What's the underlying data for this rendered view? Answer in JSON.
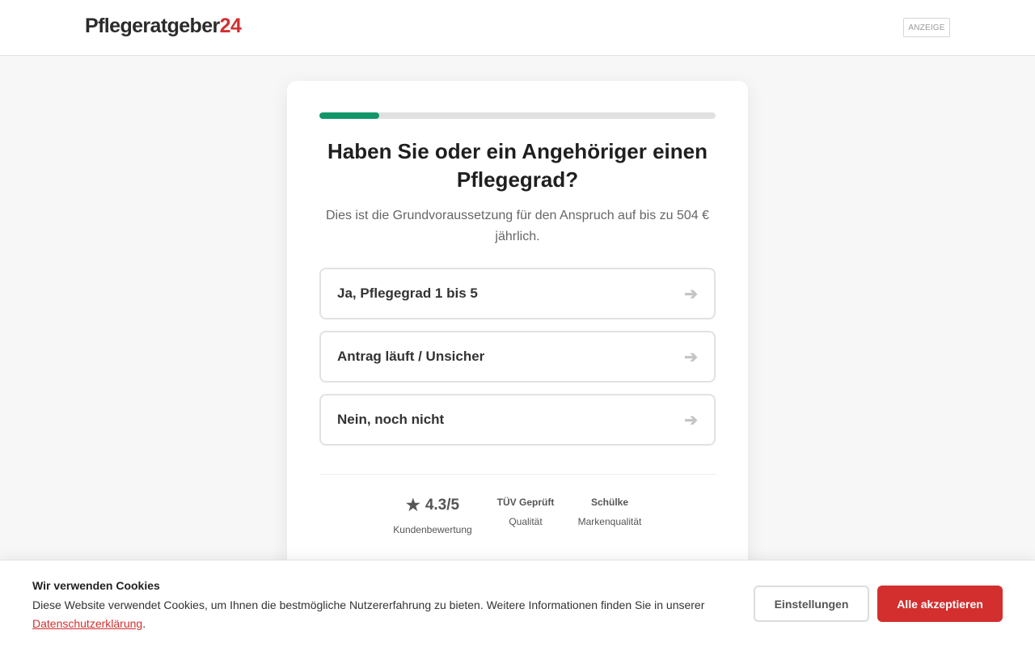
{
  "header": {
    "logo_text": "Pflegeratgeber",
    "logo_accent": "24",
    "ad_label": "ANZEIGE"
  },
  "quiz": {
    "progress_fraction": 0.15,
    "question": "Haben Sie oder ein Angehöriger einen Pflegegrad?",
    "subtitle": "Dies ist die Grundvoraussetzung für den Anspruch auf bis zu 504 € jährlich.",
    "options": [
      {
        "label": "Ja, Pflegegrad 1 bis 5",
        "icon": "arrow-right-icon"
      },
      {
        "label": "Antrag läuft / Unsicher",
        "icon": "arrow-right-icon"
      },
      {
        "label": "Nein, noch nicht",
        "icon": "arrow-right-icon"
      }
    ],
    "arrow_glyph": "➔"
  },
  "trust": {
    "rating": {
      "star": "★",
      "value": "4.3/5",
      "label": "Kundenbewertung"
    },
    "tuv": {
      "title": "TÜV Geprüft",
      "label": "Qualität"
    },
    "schuelke": {
      "title": "Schülke",
      "label": "Markenqualität"
    }
  },
  "cookie": {
    "title": "Wir verwenden Cookies",
    "text": "Diese Website verwendet Cookies, um Ihnen die bestmögliche Nutzererfahrung zu bieten. Weitere Informationen finden Sie in unserer ",
    "link": "Datenschutzerklärung",
    "text_end": ".",
    "settings_label": "Einstellungen",
    "accept_label": "Alle akzeptieren"
  },
  "colors": {
    "brand_red": "#d32f2f",
    "progress_green": "#11966a"
  }
}
